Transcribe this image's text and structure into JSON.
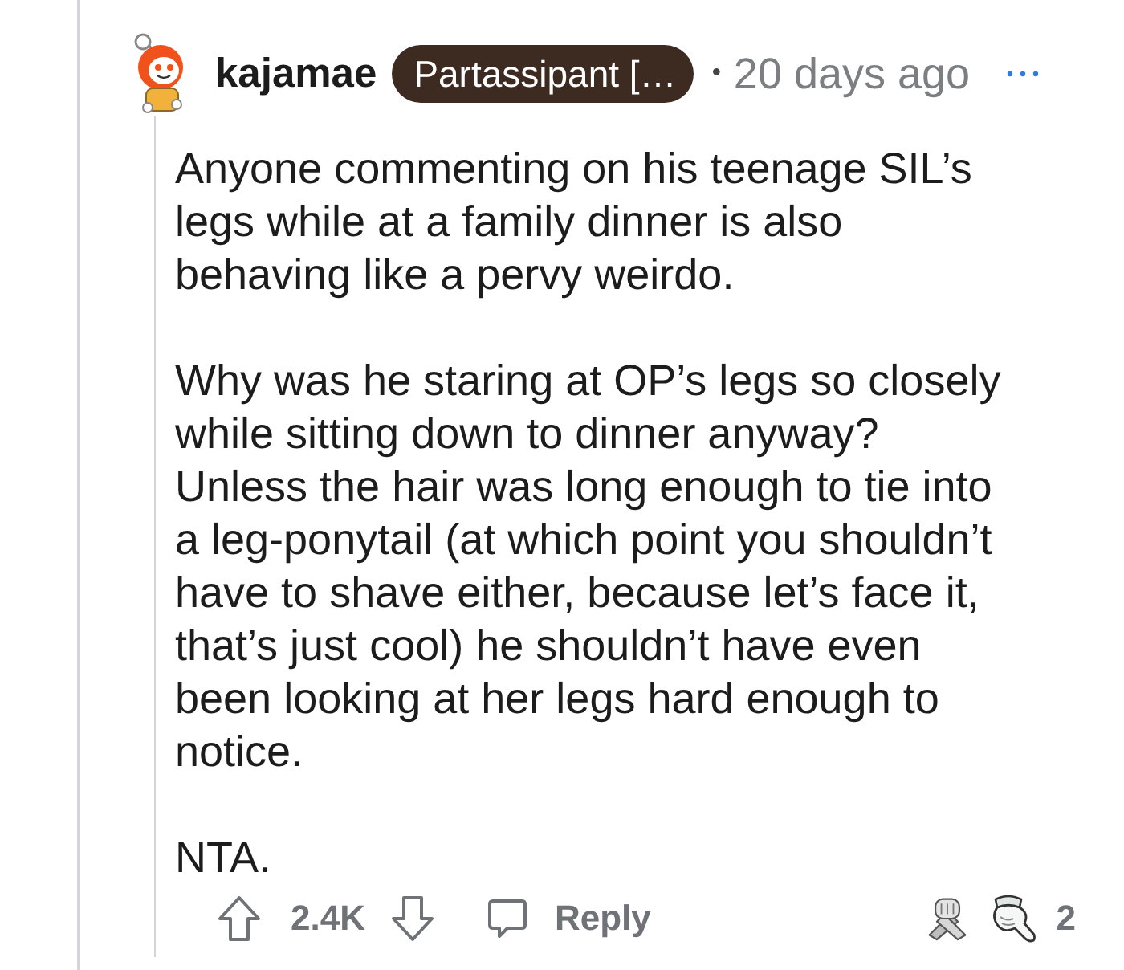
{
  "comment": {
    "author": "kajamae",
    "flair": "Partassipant […",
    "separator": "•",
    "time": "20 days ago",
    "paragraphs": [
      "Anyone commenting on his teenage SIL’s legs while at a family dinner is also behaving like a pervy weirdo.",
      "Why was he staring at OP’s legs so closely while sitting down to dinner anyway? Unless the hair was long enough to tie into a leg-ponytail (at which point you shouldn’t have to shave either, because let’s face it, that’s just cool) he shouldn’t have even been looking at her legs hard enough to notice.",
      "NTA."
    ],
    "score": "2.4K",
    "reply": "Reply",
    "award_count": "2"
  }
}
